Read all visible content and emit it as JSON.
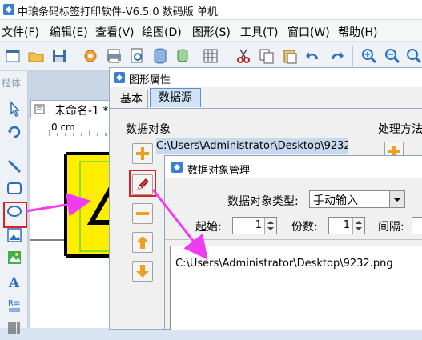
{
  "app": {
    "title": "中琅条码标签打印软件-V6.5.0 数码版 单机"
  },
  "menu": [
    "文件(F)",
    "编辑(E)",
    "查看(V)",
    "绘图(D)",
    "图形(S)",
    "工具(T)",
    "窗口(W)",
    "帮助(H)"
  ],
  "left_panel": {
    "label": "楷体"
  },
  "doc": {
    "tab_title": "未命名-1 *",
    "ruler_label": "0 cm"
  },
  "props": {
    "title": "图形属性",
    "tabs": [
      "基本",
      "数据源"
    ],
    "data_object_label": "数据对象",
    "processing_label": "处理方法",
    "data_object_value": "C:\\Users\\Administrator\\Desktop\\9232."
  },
  "manager": {
    "title": "数据对象管理",
    "type_label": "数据对象类型:",
    "type_value": "手动输入",
    "start_label": "起始:",
    "start_value": "1",
    "copies_label": "份数:",
    "copies_value": "1",
    "interval_label": "间隔:",
    "content": "C:\\Users\\Administrator\\Desktop\\9232.png"
  },
  "colors": {
    "accent": "#e02020",
    "arrow": "#f03cf0",
    "label_fill": "#ffee00"
  }
}
